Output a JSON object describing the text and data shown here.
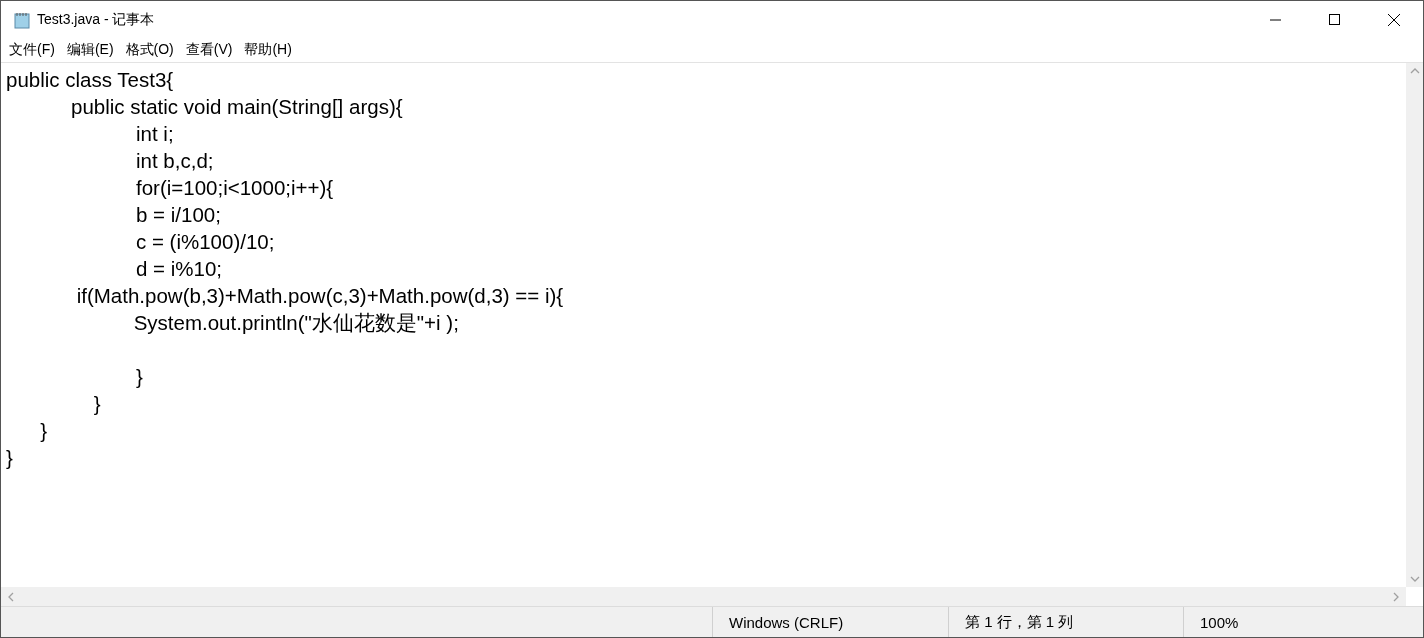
{
  "window": {
    "title": "Test3.java - 记事本"
  },
  "menu": [
    "文件(F)",
    "编辑(E)",
    "格式(O)",
    "查看(V)",
    "帮助(H)"
  ],
  "editor": {
    "lines": [
      {
        "kind": "code",
        "text": "public class Test3{"
      },
      {
        "kind": "code",
        "text": "\tpublic static void main(String[] args){"
      },
      {
        "kind": "code",
        "text": "\t\tint i;"
      },
      {
        "kind": "code",
        "text": "\t\tint b,c,d;"
      },
      {
        "kind": "code",
        "text": "\t\tfor(i=100;i<1000;i++){"
      },
      {
        "kind": "code",
        "text": "\t\tb = i/100;"
      },
      {
        "kind": "code",
        "text": "\t\tc = (i%100)/10;"
      },
      {
        "kind": "code",
        "text": "\t\td = i%10;"
      },
      {
        "kind": "code",
        "text": "\t if(Math.pow(b,3)+Math.pow(c,3)+Math.pow(d,3) == i){"
      },
      {
        "kind": "code",
        "text": "\t           System.out.println(\"水仙花数是\"+i );"
      },
      {
        "kind": "blank"
      },
      {
        "kind": "code",
        "text": "\t\t}"
      },
      {
        "kind": "code",
        "text": "\t    }"
      },
      {
        "kind": "code",
        "text": "      }"
      },
      {
        "kind": "code",
        "text": "}"
      }
    ]
  },
  "status_bar": [
    "Windows (CRLF)",
    "第 1 行，第 1 列",
    "100%"
  ]
}
